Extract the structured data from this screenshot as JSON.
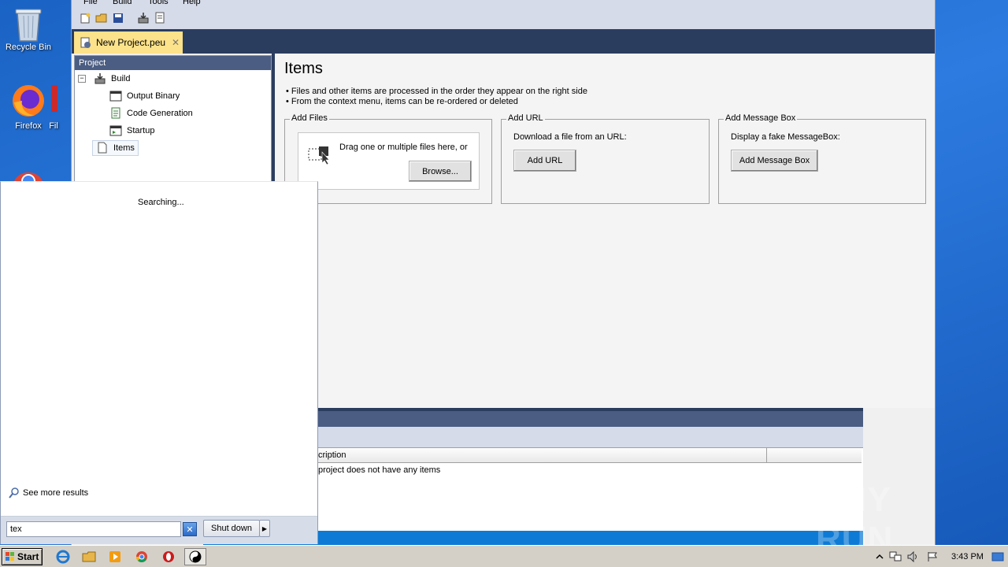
{
  "desktop": {
    "icons": [
      {
        "label": "Recycle Bin"
      },
      {
        "label": "Firefox"
      },
      {
        "label": "Fil"
      }
    ]
  },
  "menu": {
    "items": [
      "File",
      "Build",
      "Tools",
      "Help"
    ]
  },
  "doc_tab": {
    "title": "New Project.peu",
    "close": "✕"
  },
  "project_panel": {
    "header": "Project",
    "tree": [
      {
        "label": "Build",
        "expander": "−"
      },
      {
        "label": "Output Binary"
      },
      {
        "label": "Code Generation"
      },
      {
        "label": "Startup"
      },
      {
        "label": "Items"
      }
    ]
  },
  "content": {
    "title": "Items",
    "bullets": [
      "• Files and other items are processed in the order they appear on the right side",
      "• From the context menu, items can be re-ordered or deleted"
    ],
    "add_files": {
      "legend": "Add Files",
      "drop_text": "Drag one or multiple files here, or",
      "browse_button": "Browse..."
    },
    "add_url": {
      "legend": "Add URL",
      "description": "Download a file from an URL:",
      "button": "Add URL"
    },
    "add_message_box": {
      "legend": "Add Message Box",
      "description": "Display a fake MessageBox:",
      "button": "Add Message Box"
    }
  },
  "bottom_panel": {
    "column_header": "cription",
    "empty_text": "project does not have any items"
  },
  "start_menu": {
    "status": "Searching...",
    "see_more": "See more results",
    "search_value": "tex",
    "clear": "✕",
    "shutdown": "Shut down",
    "shutdown_arrow": "▶"
  },
  "taskbar": {
    "start_label": "Start",
    "clock": "3:43 PM"
  },
  "watermark": "ANY RUN"
}
